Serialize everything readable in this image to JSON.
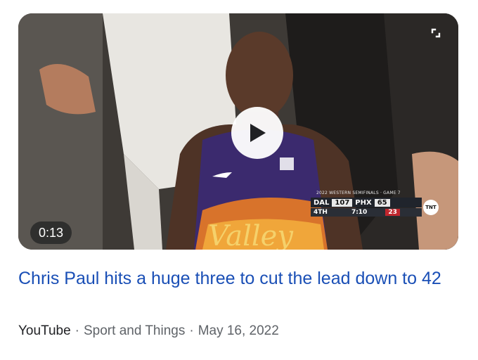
{
  "video": {
    "duration": "0:13",
    "scorebug": {
      "series": "2022 WESTERN SEMIFINALS · GAME 7",
      "team_away": "DAL",
      "score_away": "107",
      "team_home": "PHX",
      "score_home": "65",
      "quarter": "4TH",
      "clock": "7:10",
      "shot_clock": "23",
      "network": "TNT"
    },
    "jersey_text": "Valley"
  },
  "result": {
    "title": "Chris Paul hits a huge three to cut the lead down to 42",
    "source": "YouTube",
    "separator": "·",
    "channel": "Sport and Things",
    "date": "May 16, 2022"
  },
  "colors": {
    "title": "#1a4fb6",
    "meta": "#5f6368",
    "jersey_purple": "#3b2a6e"
  },
  "icons": {
    "play": "play-icon",
    "expand": "expand-icon"
  }
}
